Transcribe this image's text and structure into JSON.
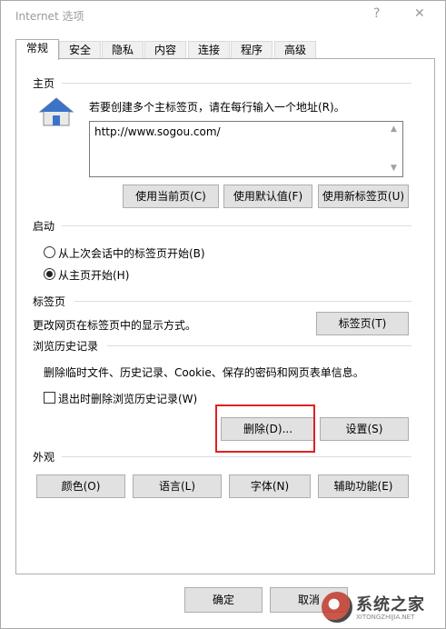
{
  "window": {
    "title": "Internet 选项",
    "help": "?",
    "close": "✕"
  },
  "tabs": [
    "常规",
    "安全",
    "隐私",
    "内容",
    "连接",
    "程序",
    "高级"
  ],
  "home": {
    "title": "主页",
    "instruction": "若要创建多个主标签页，请在每行输入一个地址(R)。",
    "url": "http://www.sogou.com/",
    "btn_current": "使用当前页(C)",
    "btn_default": "使用默认值(F)",
    "btn_new_tab": "使用新标签页(U)"
  },
  "startup": {
    "title": "启动",
    "option_last_session": "从上次会话中的标签页开始(B)",
    "option_home": "从主页开始(H)",
    "selected": "option_home"
  },
  "tabs_section": {
    "title": "标签页",
    "description": "更改网页在标签页中的显示方式。",
    "btn_tabs": "标签页(T)"
  },
  "history": {
    "title": "浏览历史记录",
    "description": "删除临时文件、历史记录、Cookie、保存的密码和网页表单信息。",
    "checkbox_label": "退出时删除浏览历史记录(W)",
    "checked": false,
    "btn_delete": "删除(D)...",
    "btn_settings": "设置(S)"
  },
  "appearance": {
    "title": "外观",
    "btn_colors": "颜色(O)",
    "btn_languages": "语言(L)",
    "btn_fonts": "字体(N)",
    "btn_accessibility": "辅助功能(E)"
  },
  "footer": {
    "ok": "确定",
    "cancel": "取消"
  },
  "watermark": {
    "text": "系统之家",
    "sub": "XITONGZHIJIA.NET"
  },
  "colors": {
    "highlight": "#e02020",
    "house_roof": "#3b73c9"
  }
}
